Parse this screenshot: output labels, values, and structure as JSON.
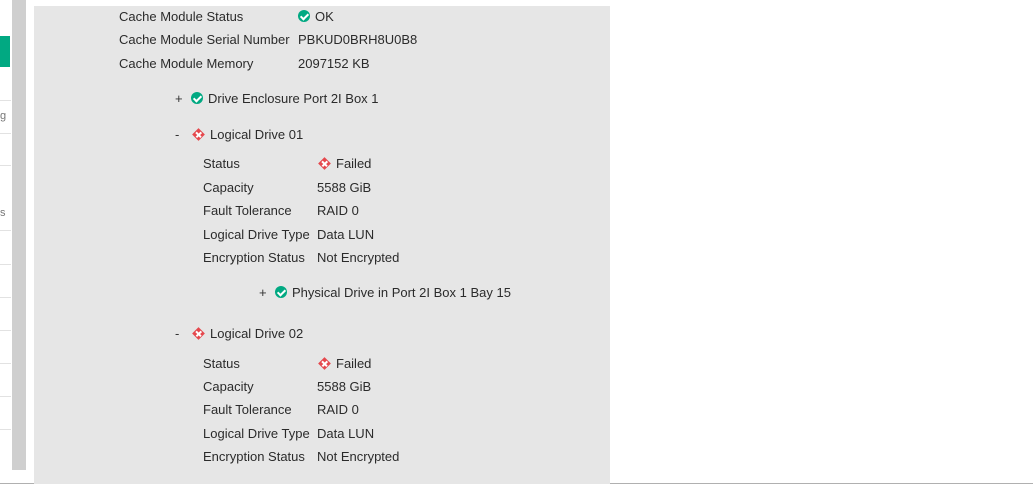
{
  "sidebar": {
    "clipped_letters": [
      "g",
      "s"
    ]
  },
  "cache_module": {
    "status_label": "Cache Module Status",
    "status_value": "OK",
    "serial_label": "Cache Module Serial Number",
    "serial_value": "PBKUD0BRH8U0B8",
    "memory_label": "Cache Module Memory",
    "memory_value": "2097152 KB"
  },
  "enclosure": {
    "toggle": "+",
    "title": "Drive Enclosure Port 2I Box 1"
  },
  "logical_drives": [
    {
      "toggle": "-",
      "title": "Logical Drive 01",
      "status_label": "Status",
      "status_value": "Failed",
      "capacity_label": "Capacity",
      "capacity_value": "5588 GiB",
      "fault_label": "Fault Tolerance",
      "fault_value": "RAID 0",
      "type_label": "Logical Drive Type",
      "type_value": "Data LUN",
      "enc_label": "Encryption Status",
      "enc_value": "Not Encrypted",
      "physical_toggle": "+",
      "physical_title": "Physical Drive in Port 2I Box 1 Bay 15"
    },
    {
      "toggle": "-",
      "title": "Logical Drive 02",
      "status_label": "Status",
      "status_value": "Failed",
      "capacity_label": "Capacity",
      "capacity_value": "5588 GiB",
      "fault_label": "Fault Tolerance",
      "fault_value": "RAID 0",
      "type_label": "Logical Drive Type",
      "type_value": "Data LUN",
      "enc_label": "Encryption Status",
      "enc_value": "Not Encrypted"
    }
  ],
  "colors": {
    "ok": "#01a982",
    "failed": "#e5484d",
    "panel_bg": "#e6e6e6"
  }
}
